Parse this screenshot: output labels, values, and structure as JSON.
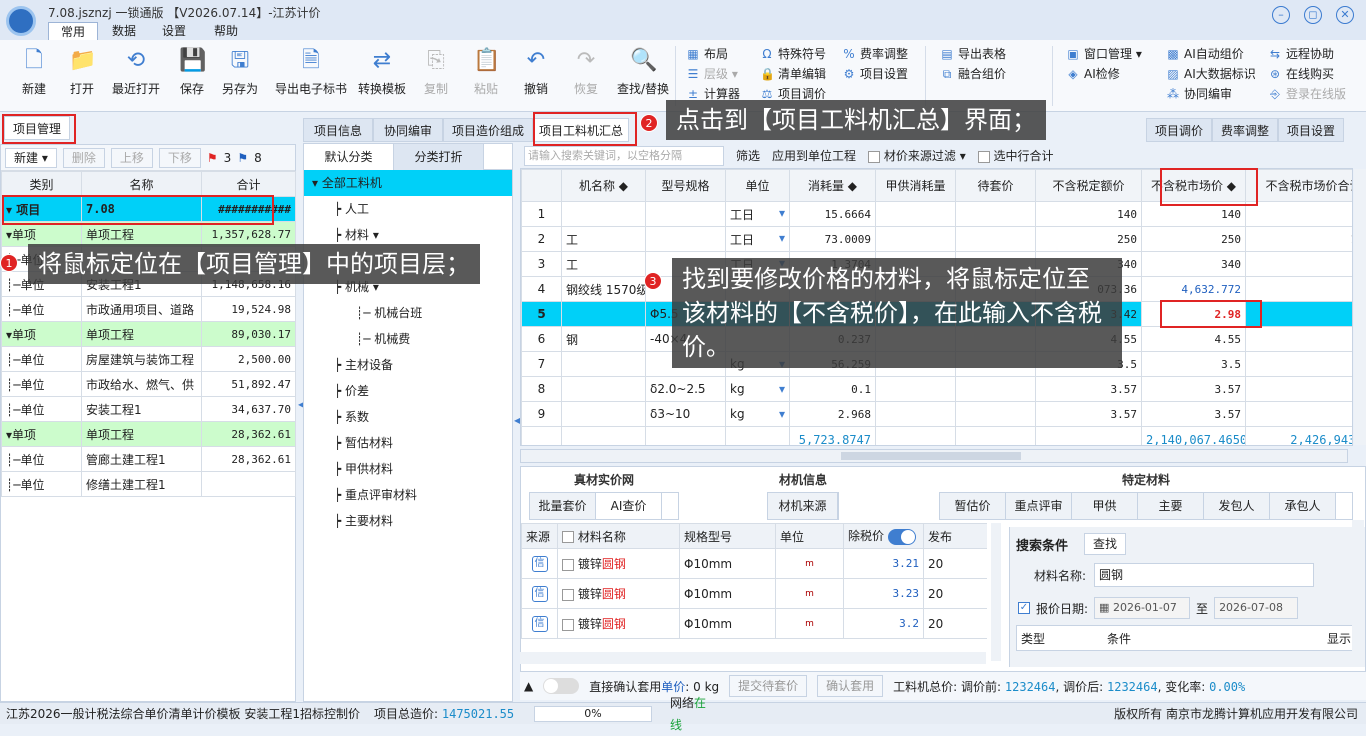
{
  "app": {
    "title": "7.08.jsznzj  一锁通版  【V2026.07.14】-江苏计价",
    "menu_tabs": [
      "常用",
      "数据",
      "设置",
      "帮助"
    ]
  },
  "ribbon": {
    "big_buttons": [
      {
        "label": "新建",
        "icon": "new-file-icon",
        "glyph": "🗋"
      },
      {
        "label": "打开",
        "icon": "open-folder-icon",
        "glyph": "📁"
      },
      {
        "label": "最近打开",
        "icon": "recent-icon",
        "glyph": "⟲"
      },
      {
        "label": "保存",
        "icon": "save-icon",
        "glyph": "💾"
      },
      {
        "label": "另存为",
        "icon": "save-as-icon",
        "glyph": "🖫"
      },
      {
        "label": "导出电子标书",
        "icon": "export-bid-icon",
        "glyph": "🗎"
      },
      {
        "label": "转换模板",
        "icon": "convert-template-icon",
        "glyph": "⇄"
      },
      {
        "label": "复制",
        "icon": "copy-icon",
        "glyph": "⎘",
        "disabled": true
      },
      {
        "label": "粘贴",
        "icon": "paste-icon",
        "glyph": "📋",
        "disabled": true
      },
      {
        "label": "撤销",
        "icon": "undo-icon",
        "glyph": "↶"
      },
      {
        "label": "恢复",
        "icon": "redo-icon",
        "glyph": "↷",
        "disabled": true
      },
      {
        "label": "查找/替换",
        "icon": "find-replace-icon",
        "glyph": "🔍"
      }
    ],
    "small_col1": [
      "布局",
      "层级",
      "计算器"
    ],
    "small_col2": [
      "特殊符号",
      "清单编辑",
      "项目调价"
    ],
    "small_col3": [
      "费率调整",
      "项目设置"
    ],
    "small_col4": [
      "导出表格",
      "融合组价"
    ],
    "small_col5": [
      "窗口管理",
      "AI检修"
    ],
    "small_col6": [
      "AI自动组价",
      "AI大数据标识",
      "协同编审"
    ],
    "small_col7": [
      "远程协助",
      "在线购买",
      "登录在线版"
    ]
  },
  "left": {
    "tab": "项目管理",
    "toolbar": {
      "new": "新建",
      "delete": "删除",
      "up": "上移",
      "down": "下移",
      "red_flag_count": "3",
      "blue_flag_count": "8"
    },
    "columns": [
      "类别",
      "名称",
      "合计"
    ],
    "rows": [
      {
        "type": "项目",
        "name": "7.08",
        "total": "###########",
        "level": 0
      },
      {
        "type": "单项",
        "name": "单项工程",
        "total": "1,357,628.77",
        "level": 1
      },
      {
        "type": "单位",
        "name": "",
        "total": "",
        "level": 2
      },
      {
        "type": "单位",
        "name": "安装工程1",
        "total": "1,148,658.16",
        "level": 2
      },
      {
        "type": "单位",
        "name": "市政通用项目、道路",
        "total": "19,524.98",
        "level": 2
      },
      {
        "type": "单项",
        "name": "单项工程",
        "total": "89,030.17",
        "level": 1
      },
      {
        "type": "单位",
        "name": "房屋建筑与装饰工程",
        "total": "2,500.00",
        "level": 2
      },
      {
        "type": "单位",
        "name": "市政给水、燃气、供",
        "total": "51,892.47",
        "level": 2
      },
      {
        "type": "单位",
        "name": "安装工程1",
        "total": "34,637.70",
        "level": 2
      },
      {
        "type": "单项",
        "name": "单项工程",
        "total": "28,362.61",
        "level": 1
      },
      {
        "type": "单位",
        "name": "管廊土建工程1",
        "total": "28,362.61",
        "level": 2
      },
      {
        "type": "单位",
        "name": "修缮土建工程1",
        "total": "",
        "level": 2
      }
    ]
  },
  "content_tabs": [
    "项目信息",
    "协同编审",
    "项目造价组成",
    "项目工料机汇总"
  ],
  "right_tabs": [
    "项目调价",
    "费率调整",
    "项目设置"
  ],
  "middle": {
    "tabs": [
      "默认分类",
      "分类打折"
    ],
    "tree": [
      {
        "label": "全部工料机",
        "level": 0,
        "selected": true
      },
      {
        "label": "人工",
        "level": 1
      },
      {
        "label": "材料",
        "level": 1
      },
      {
        "label": "",
        "level": 2
      },
      {
        "label": "机械",
        "level": 1
      },
      {
        "label": "机械台班",
        "level": 2
      },
      {
        "label": "机械费",
        "level": 2
      },
      {
        "label": "主材设备",
        "level": 1
      },
      {
        "label": "价差",
        "level": 1
      },
      {
        "label": "系数",
        "level": 1
      },
      {
        "label": "暂估材料",
        "level": 1
      },
      {
        "label": "甲供材料",
        "level": 1
      },
      {
        "label": "重点评审材料",
        "level": 1
      },
      {
        "label": "主要材料",
        "level": 1
      }
    ]
  },
  "grid": {
    "search_placeholder": "请输入搜索关键词，以空格分隔",
    "filter_label": "筛选",
    "apply_label": "应用到单位工程",
    "source_filter_label": "材价来源过滤",
    "selected_total_label": "选中行合计",
    "columns": [
      "机名称",
      "型号规格",
      "单位",
      "消耗量",
      "甲供消耗量",
      "待套价",
      "不含税定额价",
      "不含税市场价",
      "不含税市场价合计"
    ],
    "rows": [
      {
        "no": "1",
        "name": "",
        "spec": "",
        "unit": "工日",
        "qty": "15.6664",
        "jia": "",
        "dai": "",
        "quota": "140",
        "market": "140",
        "total": "2,"
      },
      {
        "no": "2",
        "name": "工",
        "spec": "",
        "unit": "工日",
        "qty": "73.0009",
        "jia": "",
        "dai": "",
        "quota": "250",
        "market": "250",
        "total": "18,2"
      },
      {
        "no": "3",
        "name": "工",
        "spec": "",
        "unit": "工日",
        "qty": "1.3704",
        "jia": "",
        "dai": "",
        "quota": "340",
        "market": "340",
        "total": "4"
      },
      {
        "no": "4",
        "name": "钢绞线 1570级",
        "spec": "",
        "unit": "",
        "qty": "",
        "jia": "",
        "dai": "",
        "quota": "073.36",
        "market": "4,632.772",
        "total": "4,8"
      },
      {
        "no": "5",
        "name": "",
        "spec": "Φ5.5",
        "unit": "",
        "qty": "",
        "jia": "",
        "dai": "",
        "quota": "3.42",
        "market": "2.98",
        "total": ""
      },
      {
        "no": "6",
        "name": "钢",
        "spec": "-40×4",
        "unit": "",
        "qty": "0.237",
        "jia": "",
        "dai": "",
        "quota": "4.55",
        "market": "4.55",
        "total": ""
      },
      {
        "no": "7",
        "name": "",
        "spec": "",
        "unit": "kg",
        "qty": "56.259",
        "jia": "",
        "dai": "",
        "quota": "3.5",
        "market": "3.5",
        "total": ""
      },
      {
        "no": "8",
        "name": "",
        "spec": "δ2.0~2.5",
        "unit": "kg",
        "qty": "0.1",
        "jia": "",
        "dai": "",
        "quota": "3.57",
        "market": "3.57",
        "total": ""
      },
      {
        "no": "9",
        "name": "",
        "spec": "δ3~10",
        "unit": "kg",
        "qty": "2.968",
        "jia": "",
        "dai": "",
        "quota": "3.57",
        "market": "3.57",
        "total": ""
      }
    ],
    "footer": {
      "qty": "5,723.8747",
      "market": "2,140,067.4650",
      "total": "2,426,943.81"
    }
  },
  "bottom": {
    "section1": "真材实价网",
    "section2": "材机信息",
    "section3": "特定材料",
    "tabs1": [
      "批量套价",
      "AI查价"
    ],
    "tabs2": [
      "材机来源"
    ],
    "tabs3": [
      "暂估价",
      "重点评审",
      "甲供",
      "主要",
      "发包人",
      "承包人"
    ],
    "price_columns": [
      "来源",
      "材料名称",
      "规格型号",
      "单位",
      "除税价",
      "发布"
    ],
    "price_rows": [
      {
        "source": "信",
        "name_prefix": "镀锌",
        "name_hl": "圆钢",
        "spec": "Φ10mm",
        "unit": "m",
        "price": "3.21",
        "pub": "20"
      },
      {
        "source": "信",
        "name_prefix": "镀锌",
        "name_hl": "圆钢",
        "spec": "Φ10mm",
        "unit": "m",
        "price": "3.23",
        "pub": "20"
      },
      {
        "source": "信",
        "name_prefix": "镀锌",
        "name_hl": "圆钢",
        "spec": "Φ10mm",
        "unit": "m",
        "price": "3.2",
        "pub": "20"
      }
    ],
    "search": {
      "title": "搜索条件",
      "find_button": "查找",
      "material_label": "材料名称:",
      "material_value": "圆钢",
      "date_label": "报价日期:",
      "date_from": "2026-01-07",
      "date_to_sep": "至",
      "date_to": "2026-07-08",
      "col_type": "类型",
      "col_cond": "条件",
      "col_show": "显示"
    },
    "actionbar": {
      "confirm_label_prefix": "直接确认套用",
      "confirm_label_blue": "单价",
      "confirm_label_mid": ":  0  kg",
      "submit": "提交待套价",
      "confirm": "确认套用",
      "summary_label": "工料机总价: 调价前:",
      "before": "1232464",
      "after_label": ", 调价后:",
      "after": "1232464",
      "rate_label": ", 变化率:",
      "rate": "0.00%"
    }
  },
  "annotations": [
    {
      "num": "1",
      "text": "将鼠标定位在【项目管理】中的项目层；"
    },
    {
      "num": "2",
      "text": "点击到【项目工料机汇总】界面；"
    },
    {
      "num": "3",
      "text": "找到要修改价格的材料，将鼠标定位至该材料的【不含税价】，在此输入不含税价。"
    }
  ],
  "status": {
    "template": "江苏2026一般计税法综合单价清单计价模板 安装工程1",
    "bid_control": "招标控制价",
    "total_label": "项目总造价:",
    "total": "1475021.55",
    "progress": "0%",
    "progress_value": 0,
    "network_label": "网络",
    "network_status": "在线",
    "copyright": "版权所有  南京市龙腾计算机应用开发有限公司"
  },
  "colors": {
    "accent": "#00d0f8",
    "highlight_red": "#e02424",
    "green_row": "#ccfccc",
    "brand_blue": "#3f7ed0"
  }
}
